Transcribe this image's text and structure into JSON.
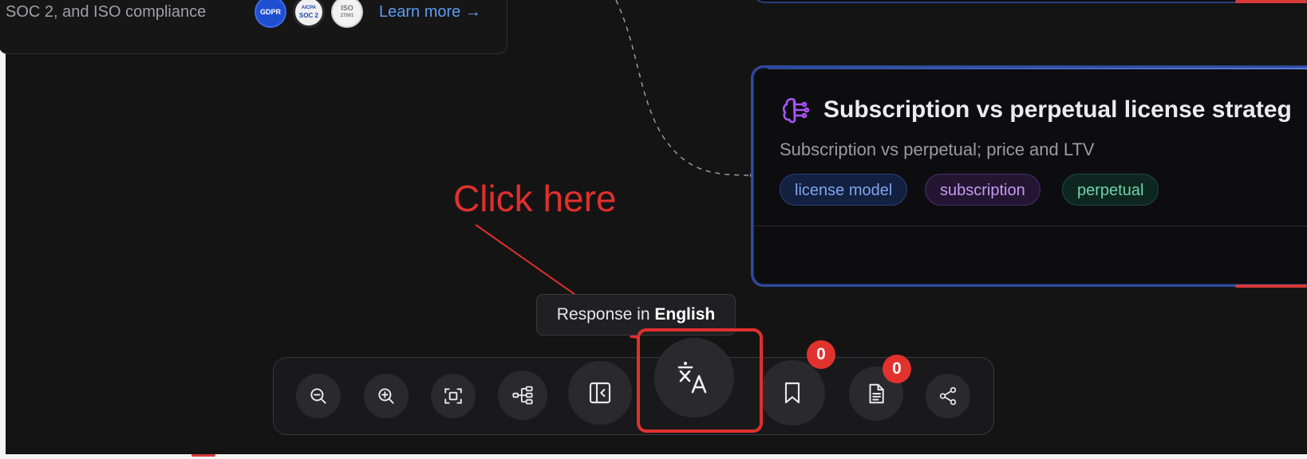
{
  "compliance": {
    "text": "SOC 2, and ISO compliance",
    "badges": [
      "GDPR",
      "AICPA",
      "SOC 2",
      "ISO",
      "27001"
    ],
    "learn_more": "Learn more →"
  },
  "card": {
    "title": "Subscription vs perpetual license strateg",
    "subtitle": "Subscription vs perpetual; price and LTV",
    "tags": [
      "license model",
      "subscription",
      "perpetual"
    ],
    "icon": "brain-icon",
    "accent_color": "#2f4a9c"
  },
  "annotation": {
    "text": "Click here",
    "color": "#e0302c"
  },
  "tooltip": {
    "prefix": "Response in",
    "language": "English"
  },
  "toolbar": {
    "buttons": [
      {
        "name": "zoom-out",
        "icon": "zoom-out-icon"
      },
      {
        "name": "zoom-in",
        "icon": "zoom-in-icon"
      },
      {
        "name": "fit-view",
        "icon": "fit-view-icon"
      },
      {
        "name": "mind-map",
        "icon": "tree-icon"
      },
      {
        "name": "toggle-panel",
        "icon": "panel-collapse-icon"
      },
      {
        "name": "translate",
        "icon": "translate-icon"
      },
      {
        "name": "bookmarks",
        "icon": "bookmark-icon"
      },
      {
        "name": "notes",
        "icon": "document-icon"
      },
      {
        "name": "share",
        "icon": "share-icon"
      }
    ],
    "bookmark_count": "0",
    "notes_count": "0"
  }
}
